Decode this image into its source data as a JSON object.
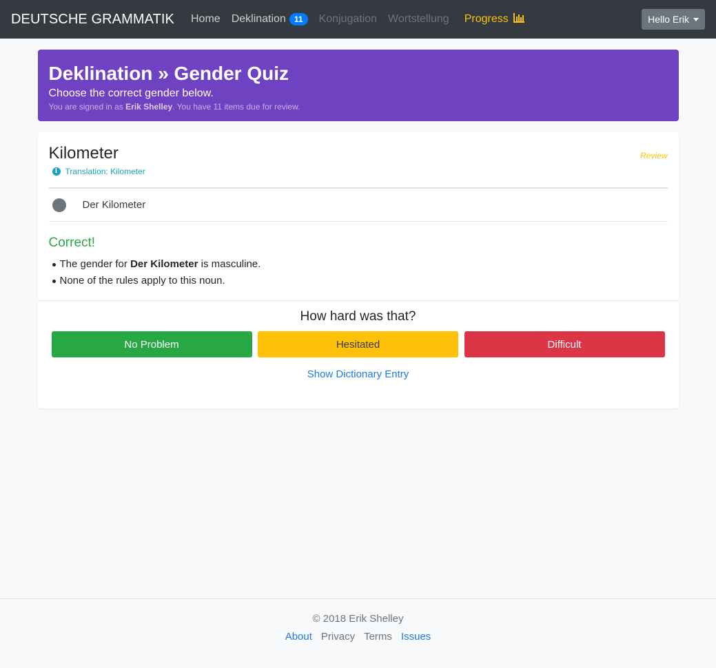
{
  "navbar": {
    "brand": "DEUTSCHE GRAMMATIK",
    "links": {
      "home": "Home",
      "deklination": "Deklination",
      "deklination_badge": "11",
      "konjugation": "Konjugation",
      "wortstellung": "Wortstellung",
      "progress": "Progress"
    },
    "user_button": "Hello Erik"
  },
  "header": {
    "title": "Deklination » Gender Quiz",
    "lead": "Choose the correct gender below.",
    "signed_in_prefix": "You are signed in as ",
    "user_name": "Erik Shelley",
    "signed_in_suffix": ". You have 11 items due for review."
  },
  "quiz": {
    "word": "Kilometer",
    "review_tag": "Review",
    "translation": "Translation: Kilometer",
    "option": "Der Kilometer",
    "result": "Correct!",
    "rule1_prefix": "The gender for ",
    "rule1_word": "Der Kilometer",
    "rule1_suffix": " is masculine.",
    "rule2": "None of the rules apply to this noun."
  },
  "difficulty": {
    "question": "How hard was that?",
    "no_problem": "No Problem",
    "hesitated": "Hesitated",
    "difficult": "Difficult",
    "dictionary_link": "Show Dictionary Entry"
  },
  "footer": {
    "copyright": "© 2018 Erik Shelley",
    "about": "About",
    "privacy": "Privacy",
    "terms": "Terms",
    "issues": "Issues"
  },
  "colors": {
    "header_bg": "#6f42c1",
    "navbar_bg": "#343a40",
    "success": "#28a745",
    "warning": "#ffc107",
    "danger": "#dc3545",
    "link": "#1e7be5"
  }
}
